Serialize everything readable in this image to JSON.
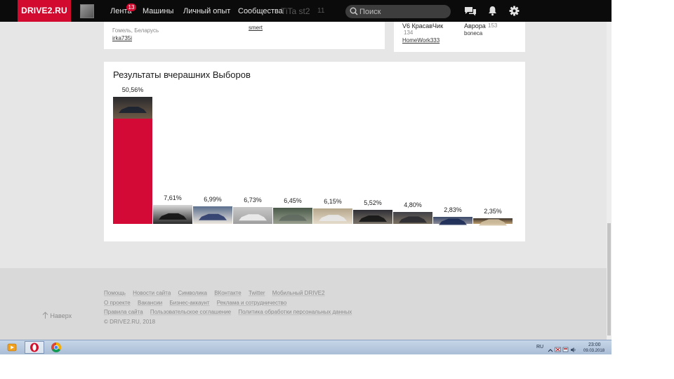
{
  "header": {
    "logo": "DRIVE2.RU",
    "nav": [
      {
        "label": "Лента",
        "badge": "13"
      },
      {
        "label": "Машины"
      },
      {
        "label": "Личный опыт"
      },
      {
        "label": "Сообщества"
      }
    ],
    "search_placeholder": "Поиск",
    "partial_text": "TiTa st2",
    "partial_count": "11"
  },
  "top_cards": {
    "left": {
      "location": "Гомель, Беларусь",
      "user1": "irka735i",
      "user2": "smert"
    },
    "right": {
      "items": [
        {
          "name": "V6 КрасавЧик",
          "count": "134",
          "user": "HomeWork333"
        },
        {
          "name": "Аврора",
          "count": "153",
          "user": "bonеса"
        }
      ]
    }
  },
  "results": {
    "title": "Результаты вчерашних Выборов"
  },
  "chart_data": {
    "type": "bar",
    "categories": [
      "1",
      "2",
      "3",
      "4",
      "5",
      "6",
      "7",
      "8",
      "9",
      "10"
    ],
    "values": [
      50.56,
      7.61,
      6.99,
      6.73,
      6.45,
      6.15,
      5.52,
      4.8,
      2.83,
      2.35
    ],
    "labels": [
      "50,56%",
      "7,61%",
      "6,99%",
      "6,73%",
      "6,45%",
      "6,15%",
      "5,52%",
      "4,80%",
      "2,83%",
      "2,35%"
    ],
    "colors": [
      "#d30a35",
      "#b5123e",
      "#b01347",
      "#a3184f",
      "#912358",
      "#822d66",
      "#703374",
      "#573b86",
      "#404894",
      "#2c54a0"
    ],
    "title": "",
    "xlabel": "",
    "ylabel": ""
  },
  "footer": {
    "row1": [
      "Помощь",
      "Новости сайта",
      "Символика",
      "ВКонтакте",
      "Twitter",
      "Мобильный DRIVE2"
    ],
    "row2": [
      "О проекте",
      "Вакансии",
      "Бизнес-аккаунт",
      "Реклама и сотрудничество"
    ],
    "row3": [
      "Правила сайта",
      "Пользовательское соглашение",
      "Политика обработки персональных данных"
    ],
    "copyright": "© DRIVE2.RU, 2018",
    "back_to_top": "Наверх"
  },
  "taskbar": {
    "lang": "RU",
    "time": "23:00",
    "date": "09.03.2018"
  },
  "colors": {
    "brand": "#d30a2f",
    "header_bg": "#0b0b0b",
    "page_bg": "#e6e6e6"
  }
}
